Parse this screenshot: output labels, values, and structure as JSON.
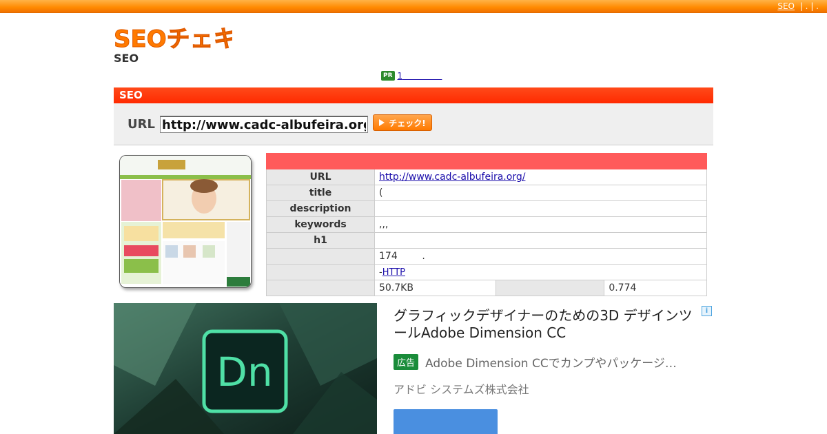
{
  "topbar": {
    "link_label": "SEO",
    "separators": "| . | ."
  },
  "header": {
    "logo_text": "SEOチェキ!",
    "subtitle": "SEO"
  },
  "pr": {
    "badge": "PR",
    "link_text": "1"
  },
  "checker": {
    "section_title": "SEO",
    "url_label": "URL",
    "url_value": "http://www.cadc-albufeira.org/",
    "button_label": "チェック!"
  },
  "results": {
    "rows": [
      {
        "label": "URL",
        "value": "http://www.cadc-albufeira.org/"
      },
      {
        "label": "title",
        "value": "("
      },
      {
        "label": "description",
        "value": ""
      },
      {
        "label": "keywords",
        "value": ",,,"
      },
      {
        "label": "h1",
        "value": ""
      },
      {
        "label": "",
        "value": "174        ."
      },
      {
        "label": "",
        "value_prefix": "-",
        "value_link": "HTTP"
      },
      {
        "label": "",
        "value": "50.7KB",
        "extra_label": "",
        "extra_value": "0.774"
      }
    ]
  },
  "ad": {
    "title": "グラフィックデザイナーのための3D デザインツールAdobe Dimension CC",
    "badge": "広告",
    "description": "Adobe Dimension CCでカンプやパッケージ…",
    "company": "アドビ システムズ株式会社",
    "image_logo_text": "Dn",
    "info_icon": "info-icon"
  },
  "colors": {
    "topbar": "#ff8a00",
    "section_header": "#ff2a00",
    "table_head": "#ff5a5a",
    "ad_badge": "#1a8c3a",
    "ad_button": "#4a8fe0"
  }
}
